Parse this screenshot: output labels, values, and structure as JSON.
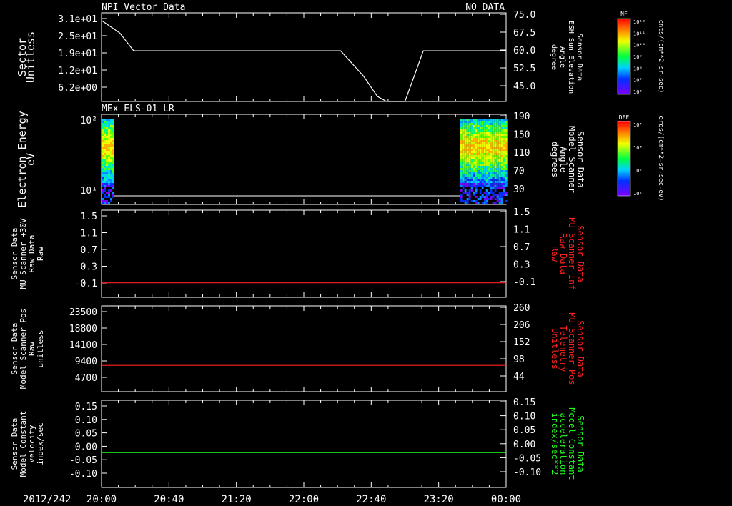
{
  "colors": {
    "bg": "#000000",
    "fg": "#ffffff",
    "red": "#ff2020",
    "green": "#20ff20"
  },
  "bottom_axis": {
    "date_label": "2012/242",
    "ticks": [
      "20:00",
      "20:40",
      "21:20",
      "22:00",
      "22:40",
      "23:20",
      "00:00"
    ]
  },
  "chart_data": [
    {
      "type": "line",
      "title": "NPI Vector Data",
      "status": "NO DATA",
      "ylabel_left": [
        "Sector",
        "Unitless"
      ],
      "left_ticks": [
        "3.1e+01",
        "2.5e+01",
        "1.9e+01",
        "1.2e+01",
        "6.2e+00"
      ],
      "ylabel_right": [
        "Sensor Data",
        "ESH Sun Elevation",
        "Angle",
        "degree"
      ],
      "right_ticks": [
        "75.0",
        "67.5",
        "60.0",
        "52.5",
        "45.0"
      ],
      "ylim_right": [
        40,
        75
      ],
      "series": [
        {
          "color": "#ffffff",
          "x": [
            0,
            0.2,
            0.35,
            0.5,
            2.6,
            2.85,
            3.0,
            3.1,
            3.15,
            3.3,
            3.4,
            3.5,
            4.4
          ],
          "y": [
            72,
            67,
            60,
            60,
            60,
            50,
            42,
            40,
            40,
            40,
            50,
            60,
            60
          ]
        }
      ]
    },
    {
      "type": "heatmap",
      "title": "MEx ELS-01 LR",
      "ylabel_left": [
        "Electron Energy",
        "eV"
      ],
      "left_ticks": [
        "10²",
        "10¹"
      ],
      "ylabel_right": [
        "Sensor Data",
        "Model Scanner",
        "Angle",
        "degrees"
      ],
      "right_ticks": [
        "190",
        "150",
        "110",
        "70",
        "30"
      ],
      "active_ranges": [
        [
          0,
          0.12
        ],
        [
          3.9,
          4.4
        ]
      ],
      "colorbar": {
        "label": "DEF",
        "units": "ergs/(cm**2-sr-sec-eV)",
        "ticks": [
          "10⁴",
          "10³",
          "10²",
          "10¹"
        ]
      }
    },
    {
      "type": "line",
      "ylabel_left": [
        "Sensor Data",
        "MU Scanner +30V",
        "Raw Data",
        "Raw"
      ],
      "left_ticks": [
        "1.5",
        "1.1",
        "0.7",
        "0.3",
        "-0.1"
      ],
      "ylabel_right": [
        "Sensor Data",
        "MU Scanner Inf",
        "Raw Data",
        "Raw"
      ],
      "right_ticks": [
        "1.5",
        "1.1",
        "0.7",
        "0.3",
        "-0.1"
      ],
      "ylim": [
        -0.3,
        1.5
      ],
      "series": [
        {
          "color": "#ff2020",
          "x": [
            0,
            4.4
          ],
          "y": [
            0,
            0
          ]
        }
      ]
    },
    {
      "type": "line",
      "ylabel_left": [
        "Sensor Data",
        "Model Scanner Pos",
        "Raw",
        "unitless"
      ],
      "left_ticks": [
        "23500",
        "18800",
        "14100",
        "9400",
        "4700"
      ],
      "ylabel_right": [
        "Sensor Data",
        "MU Scanner Pos",
        "Telemetry",
        "Unitless"
      ],
      "right_ticks": [
        "260",
        "206",
        "152",
        "98",
        "44"
      ],
      "ylim": [
        0,
        23500
      ],
      "series": [
        {
          "color": "#ff2020",
          "x": [
            0,
            4.4
          ],
          "y": [
            7200,
            7200
          ]
        }
      ]
    },
    {
      "type": "line",
      "ylabel_left": [
        "Sensor Data",
        "Model Constant",
        "velocity",
        "index/sec"
      ],
      "left_ticks": [
        "0.15",
        "0.10",
        "0.05",
        "0.00",
        "-0.05",
        "-0.10"
      ],
      "ylabel_right": [
        "Sensor Data",
        "Model Constant",
        "acceleration",
        "index/sec**2"
      ],
      "right_ticks": [
        "0.15",
        "0.10",
        "0.05",
        "0.00",
        "-0.05",
        "-0.10"
      ],
      "ylim": [
        -0.1,
        0.15
      ],
      "series": [
        {
          "color": "#20ff20",
          "x": [
            0,
            4.4
          ],
          "y": [
            0,
            0
          ]
        }
      ]
    }
  ],
  "colorbar_top": {
    "label": "NF",
    "units": "cnts/(cm**2-sr-sec)",
    "ticks": [
      "10¹²",
      "10¹¹",
      "10¹⁰",
      "10⁹",
      "10⁸",
      "10⁷",
      "10⁶"
    ]
  }
}
